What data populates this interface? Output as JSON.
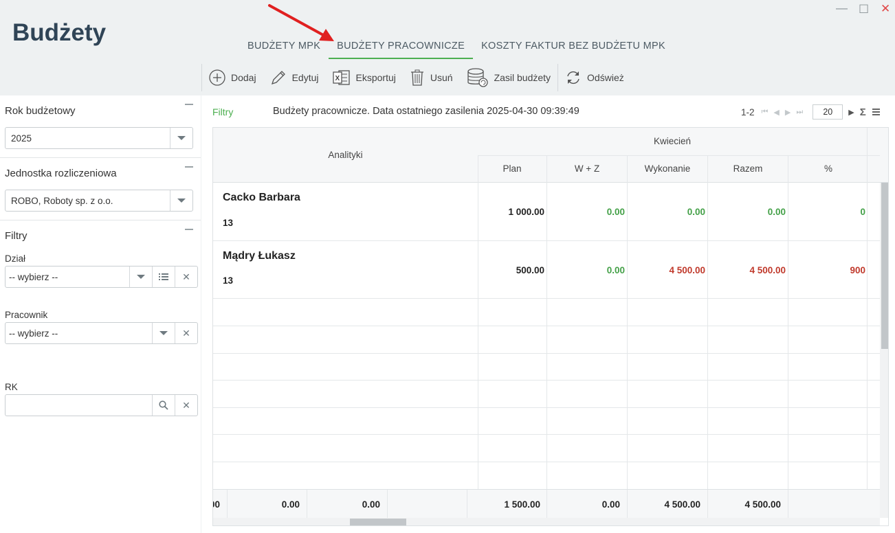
{
  "app": {
    "title": "Budżety"
  },
  "window": {
    "min": "—",
    "max": "☐",
    "close": "✕"
  },
  "tabs": [
    {
      "label": "BUDŻETY MPK",
      "active": false
    },
    {
      "label": "BUDŻETY PRACOWNICZE",
      "active": true
    },
    {
      "label": "KOSZTY FAKTUR BEZ BUDŻETU MPK",
      "active": false
    }
  ],
  "toolbar": {
    "add": "Dodaj",
    "edit": "Edytuj",
    "export": "Eksportuj",
    "delete": "Usuń",
    "feed": "Zasil budżety",
    "refresh": "Odśwież"
  },
  "sidebar": {
    "year": {
      "title": "Rok budżetowy",
      "value": "2025"
    },
    "unit": {
      "title": "Jednostka rozliczeniowa",
      "value": "ROBO, Roboty sp. z o.o."
    },
    "filters": {
      "title": "Filtry",
      "dept": {
        "label": "Dział",
        "placeholder": "-- wybierz --"
      },
      "employee": {
        "label": "Pracownik",
        "placeholder": "-- wybierz --"
      },
      "rk": {
        "label": "RK",
        "value": ""
      }
    }
  },
  "grid": {
    "filters_link": "Filtry",
    "title": "Budżety pracownicze. Data ostatniego zasilenia 2025-04-30 09:39:49",
    "pager": {
      "range": "1-2",
      "page_size": "20"
    },
    "headers": {
      "analytics": "Analityki",
      "month": "Kwiecień",
      "plan": "Plan",
      "wz": "W + Z",
      "exec": "Wykonanie",
      "total": "Razem",
      "pct": "%"
    },
    "rows": [
      {
        "name": "Cacko Barbara",
        "num": "13",
        "plan": "1 000.00",
        "wz": "0.00",
        "exec": "0.00",
        "total": "0.00",
        "pct": "0"
      },
      {
        "name": "Mądry Łukasz",
        "num": "13",
        "plan": "500.00",
        "wz": "0.00",
        "exec": "4 500.00",
        "total": "4 500.00",
        "pct": "900"
      }
    ],
    "footer": {
      "c0": "00",
      "c1": "0.00",
      "c2": "0.00",
      "plan": "1 500.00",
      "wz": "0.00",
      "exec": "4 500.00",
      "total": "4 500.00"
    }
  },
  "colors": {
    "accent": "#4caf50",
    "positive": "#43a047",
    "negative": "#c0392b",
    "title": "#2f4456"
  }
}
